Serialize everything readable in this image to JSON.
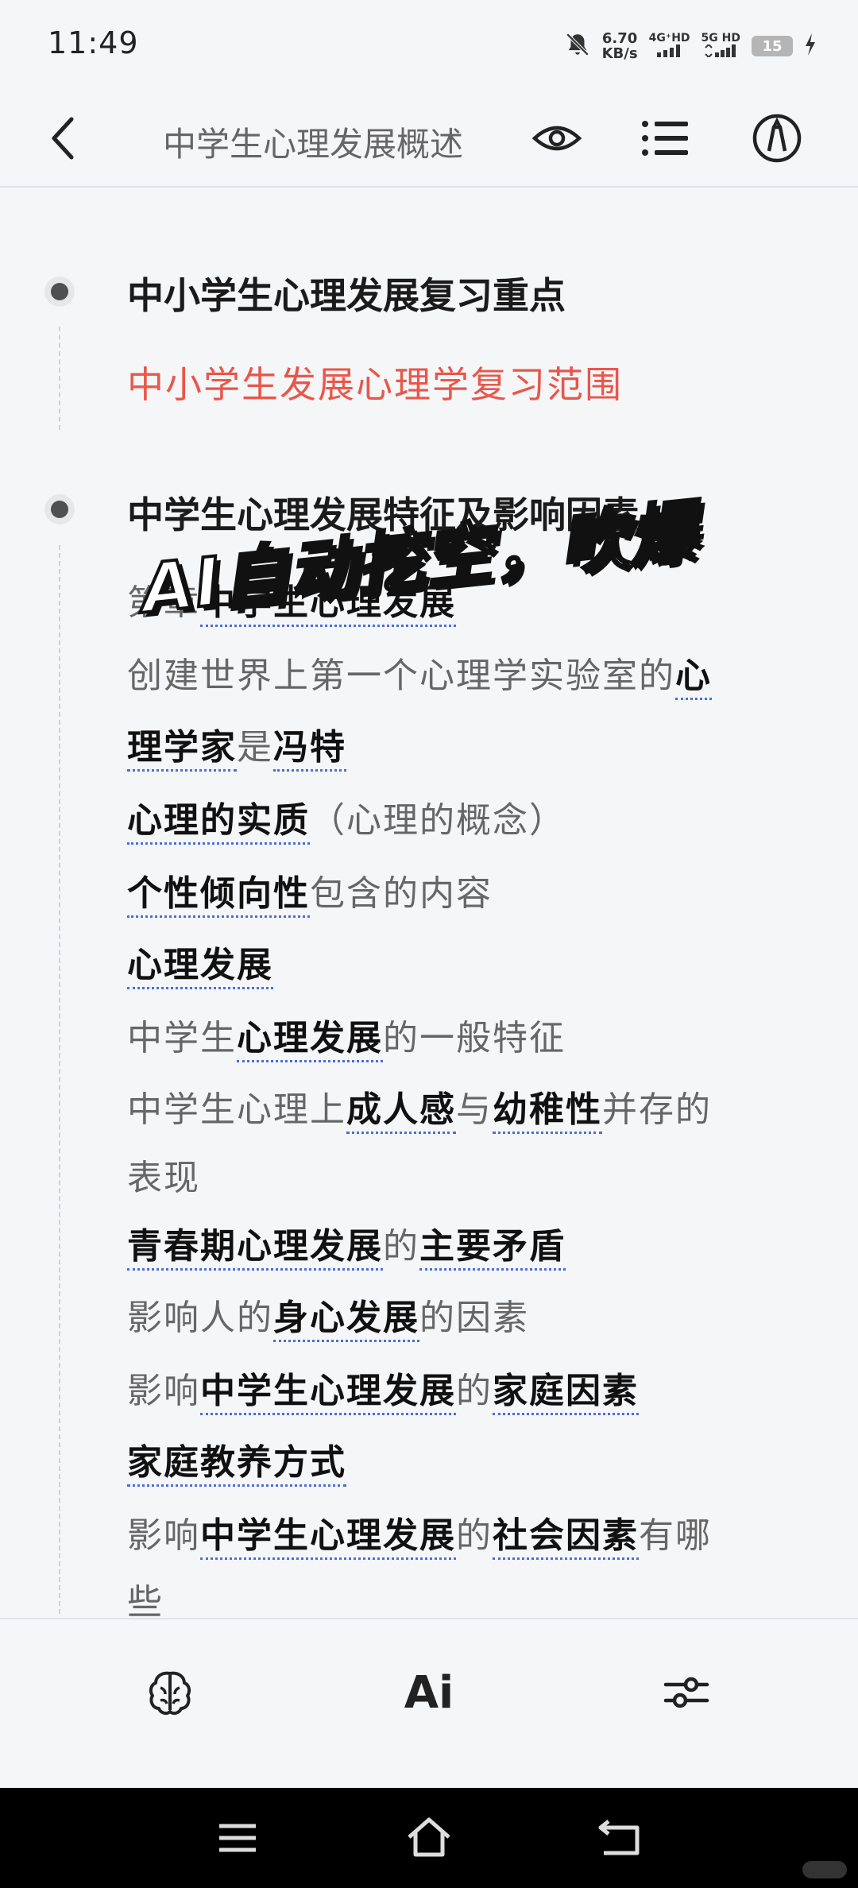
{
  "status_bar": {
    "time": "11:49",
    "speed_value": "6.70",
    "speed_unit": "KB/s",
    "net1_top": "4G⁺HD",
    "net2_top": "5G HD",
    "battery": "15"
  },
  "header": {
    "title": "中学生心理发展概述"
  },
  "sections": [
    {
      "heading": "中小学生心理发展复习重点",
      "subtitle": "中小学生发展心理学复习范围"
    },
    {
      "heading": "中学生心理发展特征及影响因素"
    }
  ],
  "lines": {
    "l1": {
      "a": "第",
      "b": "章",
      "c": "中学生心理发展"
    },
    "l2": {
      "a": "创建世界上第一个心理学实验室的",
      "b": "心"
    },
    "l3": {
      "a": "理学家",
      "b": "是",
      "c": "冯特"
    },
    "l4": {
      "a": "心理的实质",
      "b": "（心理的概念）"
    },
    "l5": {
      "a": "个性倾向性",
      "b": "包含的内容"
    },
    "l6": {
      "a": "心理发展"
    },
    "l7": {
      "a": "中学生",
      "b": "心理发展",
      "c": "的一般特征"
    },
    "l8": {
      "a": "中学生心理上",
      "b": "成人感",
      "c": "与",
      "d": "幼稚性",
      "e": "并存的"
    },
    "l9": {
      "a": "表现"
    },
    "l10": {
      "a": "青春期心理发展",
      "b": "的",
      "c": "主要矛盾"
    },
    "l11": {
      "a": "影响人的",
      "b": "身心发展",
      "c": "的因素"
    },
    "l12": {
      "a": "影响",
      "b": "中学生心理发展",
      "c": "的",
      "d": "家庭因素"
    },
    "l13": {
      "a": "家庭教养方式"
    },
    "l14": {
      "a": "影响",
      "b": "中学生心理发展",
      "c": "的",
      "d": "社会因素",
      "e": "有哪"
    },
    "l15": {
      "a": "些"
    }
  },
  "overlay": {
    "banner": "AI自动挖空，吹爆"
  },
  "toolbar": {
    "ai_label": "Ai"
  },
  "colors": {
    "accent_red": "#e8574a",
    "keyword_underline": "#4a6de0"
  }
}
